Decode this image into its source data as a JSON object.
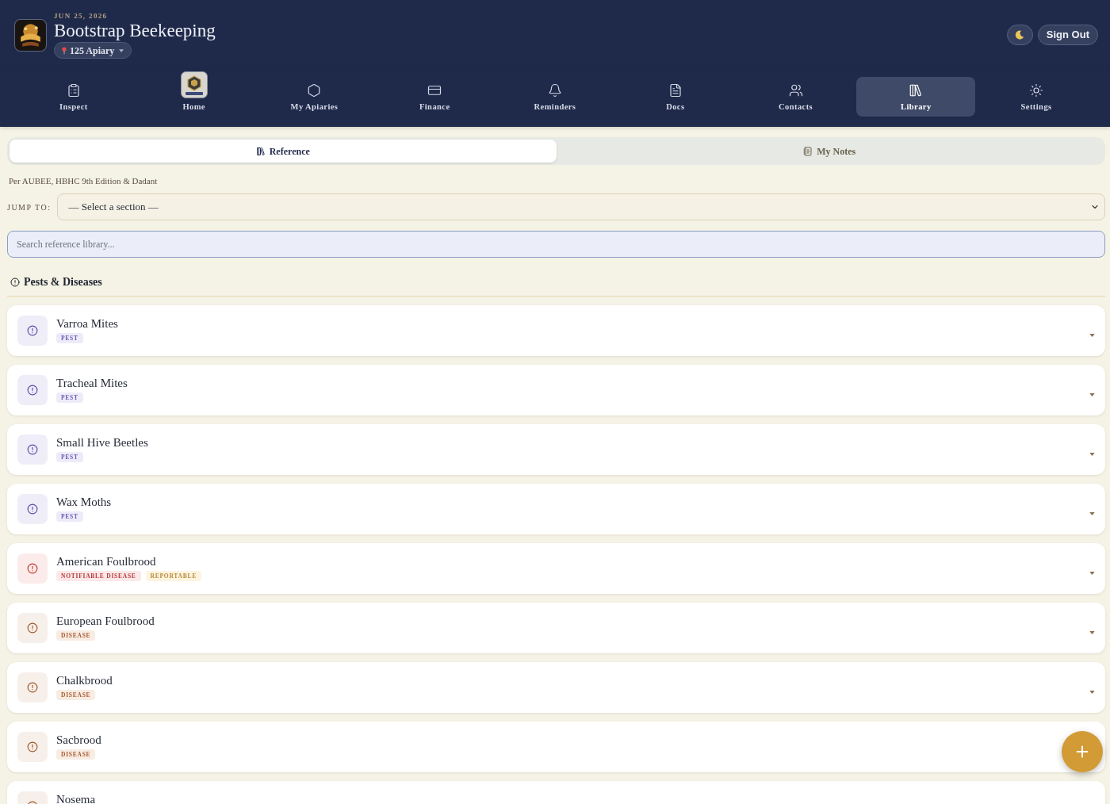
{
  "header": {
    "date": "JUN 25, 2026",
    "title": "Bootstrap Beekeeping",
    "apiary_picker": {
      "label": "125 Apiary"
    },
    "sign_out": "Sign Out"
  },
  "nav": [
    {
      "label": "Inspect",
      "selected": false
    },
    {
      "label": "Home",
      "selected": false
    },
    {
      "label": "My Apiaries",
      "selected": false
    },
    {
      "label": "Finance",
      "selected": false
    },
    {
      "label": "Reminders",
      "selected": false
    },
    {
      "label": "Docs",
      "selected": false
    },
    {
      "label": "Contacts",
      "selected": false
    },
    {
      "label": "Library",
      "selected": true
    },
    {
      "label": "Settings",
      "selected": false
    }
  ],
  "tabs": [
    {
      "label": "Reference",
      "selected": true
    },
    {
      "label": "My Notes",
      "selected": false
    }
  ],
  "source_note": "Per AUBEE, HBHC 9th Edition & Dadant",
  "jump_to": {
    "label": "JUMP TO:",
    "value": "— Select a section —"
  },
  "search": {
    "placeholder": "Search reference library..."
  },
  "section": {
    "title": "Pests & Diseases",
    "items": [
      {
        "title": "Varroa Mites",
        "kind": "pest",
        "expanded": false,
        "badges": [
          {
            "label": "PEST",
            "kind": "pest"
          }
        ]
      },
      {
        "title": "Tracheal Mites",
        "kind": "pest",
        "expanded": false,
        "badges": [
          {
            "label": "PEST",
            "kind": "pest"
          }
        ]
      },
      {
        "title": "Small Hive Beetles",
        "kind": "pest",
        "expanded": false,
        "badges": [
          {
            "label": "PEST",
            "kind": "pest"
          }
        ]
      },
      {
        "title": "Wax Moths",
        "kind": "pest",
        "expanded": false,
        "badges": [
          {
            "label": "PEST",
            "kind": "pest"
          }
        ]
      },
      {
        "title": "American Foulbrood",
        "kind": "notifiable",
        "expanded": false,
        "badges": [
          {
            "label": "NOTIFIABLE DISEASE",
            "kind": "notifiable"
          },
          {
            "label": "REPORTABLE",
            "kind": "reportable"
          }
        ]
      },
      {
        "title": "European Foulbrood",
        "kind": "disease",
        "expanded": false,
        "badges": [
          {
            "label": "DISEASE",
            "kind": "disease"
          }
        ]
      },
      {
        "title": "Chalkbrood",
        "kind": "disease",
        "expanded": false,
        "badges": [
          {
            "label": "DISEASE",
            "kind": "disease"
          }
        ]
      },
      {
        "title": "Sacbrood",
        "kind": "disease",
        "badges": [
          {
            "label": "DISEASE",
            "kind": "disease"
          }
        ]
      },
      {
        "title": "Nosema",
        "kind": "disease"
      }
    ]
  }
}
